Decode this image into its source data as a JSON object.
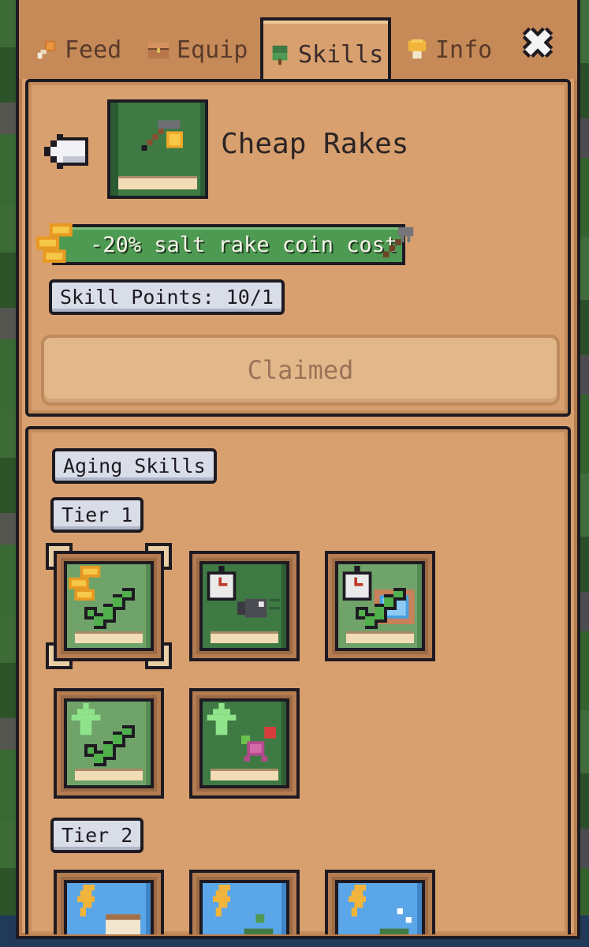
{
  "tabs": [
    {
      "label": "Feed",
      "icon": "drumstick-icon",
      "active": false
    },
    {
      "label": "Equip",
      "icon": "chest-icon",
      "active": false
    },
    {
      "label": "Skills",
      "icon": "clover-icon",
      "active": true
    },
    {
      "label": "Info",
      "icon": "mushroom-icon",
      "active": false
    }
  ],
  "close_icon": "close-icon",
  "detail": {
    "title": "Cheap Rakes",
    "effect": "-20% salt rake coin cost",
    "skill_points": "Skill Points: 10/1",
    "claim_button": "Claimed"
  },
  "skills": {
    "section_title": "Aging Skills",
    "tier1": "Tier 1",
    "tier2": "Tier 2"
  },
  "colors": {
    "panel": "#d8a06e",
    "accent_green": "#4f9a52",
    "outline": "#1e1a22"
  }
}
